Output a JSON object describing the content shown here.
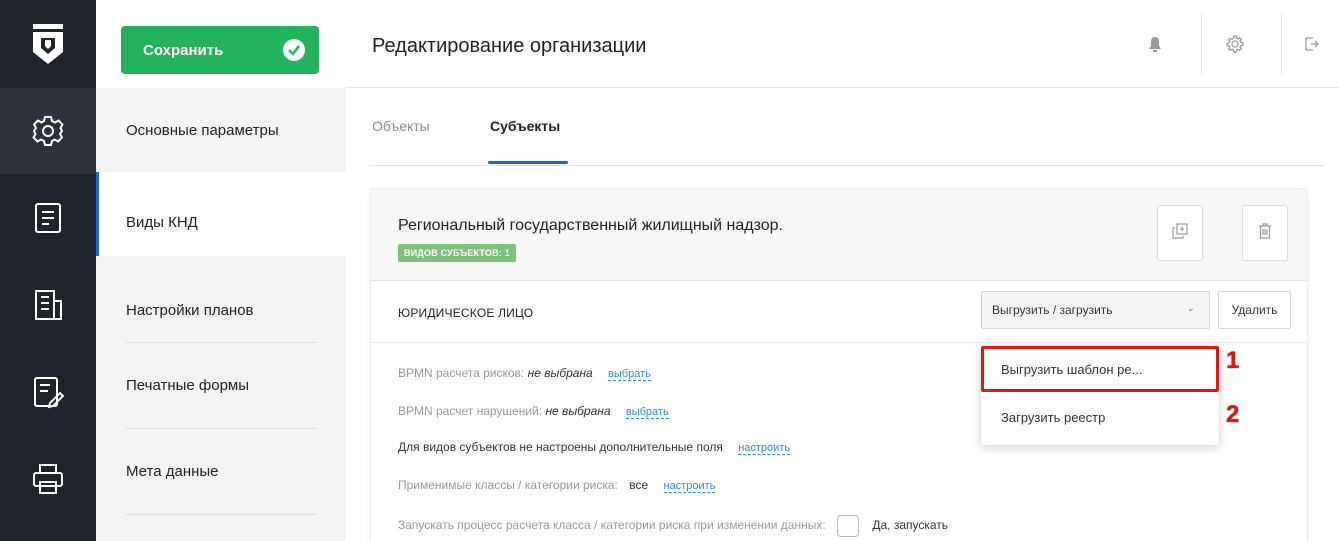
{
  "colors": {
    "rail": "#1f232b",
    "save_green": "#22b35b",
    "accent_blue": "#1a66d9",
    "link_blue": "#2b8fd6",
    "badge_green": "#7fc27a",
    "highlight_red": "#e51414"
  },
  "rail": {
    "logo_icon": "shield-logo-icon",
    "items": [
      {
        "icon": "gear-icon"
      },
      {
        "icon": "document-icon"
      },
      {
        "icon": "building-icon"
      },
      {
        "icon": "edit-list-icon"
      },
      {
        "icon": "printer-icon"
      }
    ]
  },
  "toolbar": {
    "save_label": "Сохранить"
  },
  "header": {
    "title": "Редактирование организации",
    "icons": [
      "bell-icon",
      "settings-icon",
      "logout-icon"
    ]
  },
  "menu": {
    "items": [
      {
        "label": "Основные параметры"
      },
      {
        "label": "Виды КНД"
      },
      {
        "label": "Настройки планов"
      },
      {
        "label": "Печатные формы"
      },
      {
        "label": "Мета данные"
      }
    ]
  },
  "tabs": [
    {
      "label": "Объекты"
    },
    {
      "label": "Субъекты"
    }
  ],
  "card": {
    "title": "Региональный государственный жилищный надзор.",
    "badge": "ВИДОВ СУБЪЕКТОВ: 1",
    "section_title": "ЮРИДИЧЕСКОЕ ЛИЦО",
    "export_import_label": "Выгрузить / загрузить",
    "delete_label": "Удалить",
    "rows": {
      "bpmn_risk_label": "BPMN расчета рисков:",
      "bpmn_risk_value": "не выбрана",
      "bpmn_risk_link": "выбрать",
      "bpmn_violation_label": "BPMN расчет нарушений:",
      "bpmn_violation_value": "не выбрана",
      "bpmn_violation_link": "выбрать",
      "extra_fields_text": "Для видов субъектов не настроены дополнительные поля",
      "extra_fields_link": "настроить",
      "risk_classes_label": "Применимые классы / категории риска:",
      "risk_classes_value": "все",
      "risk_classes_link": "настроить",
      "run_process_label": "Запускать процесс расчета класса / категории риска при изменении данных:",
      "run_process_option": "Да, запускать"
    }
  },
  "dropdown": {
    "items": [
      {
        "label": "Выгрузить шаблон ре..."
      },
      {
        "label": "Загрузить реестр"
      }
    ]
  },
  "callouts": [
    "1",
    "2"
  ]
}
